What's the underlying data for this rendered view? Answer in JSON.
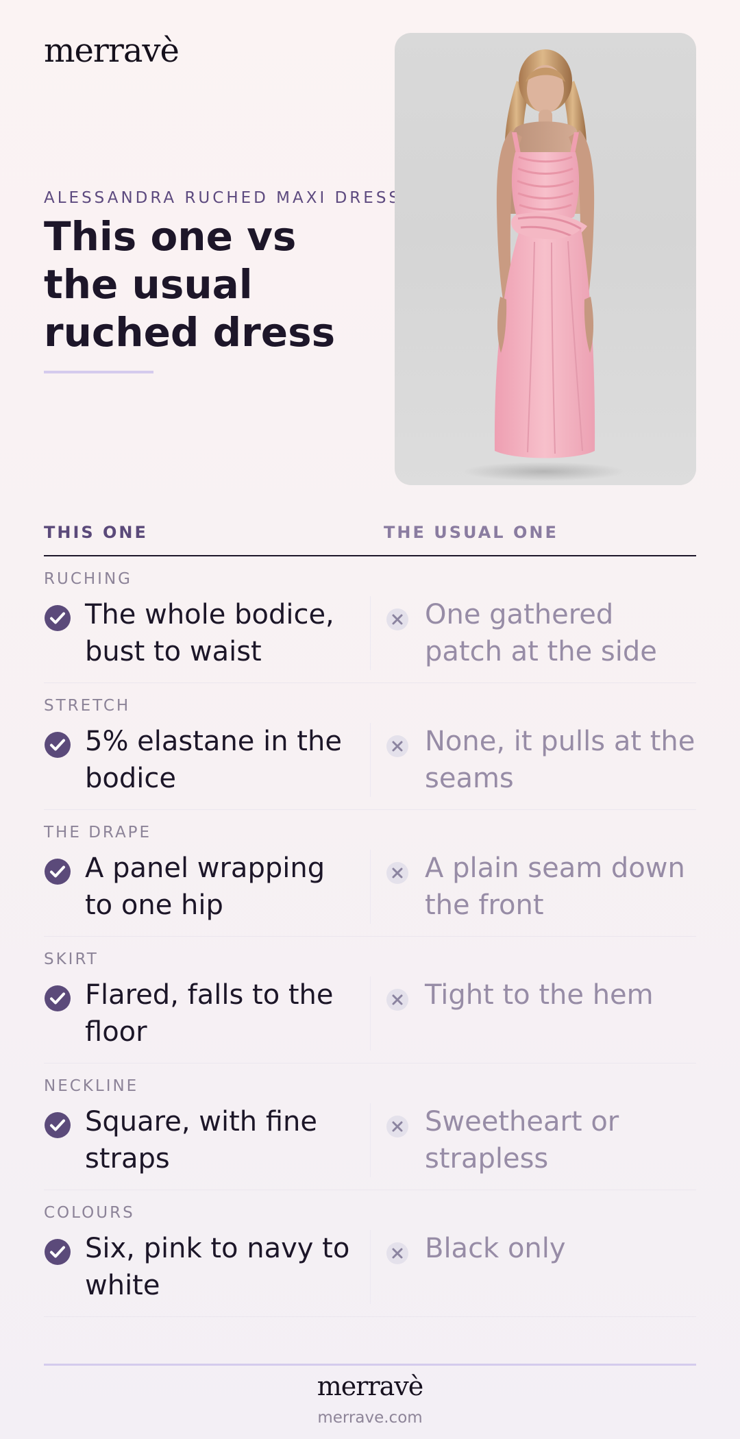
{
  "brand": {
    "name": "merravè",
    "url": "merrave.com"
  },
  "header": {
    "eyebrow": "ALESSANDRA RUCHED MAXI DRESS",
    "headline": "This one vs the usual ruched dress"
  },
  "image": {
    "subject": "pink maxi dress model"
  },
  "comparison": {
    "left_header": "THIS ONE",
    "right_header": "THE USUAL ONE",
    "rows": [
      {
        "label": "RUCHING",
        "left": "The whole bodice, bust to waist",
        "right": "One gathered patch at the side"
      },
      {
        "label": "STRETCH",
        "left": "5% elastane in the bodice",
        "right": "None, it pulls at the seams"
      },
      {
        "label": "THE DRAPE",
        "left": "A panel wrapping to one hip",
        "right": "A plain seam down the front"
      },
      {
        "label": "SKIRT",
        "left": "Flared, falls to the floor",
        "right": "Tight to the hem"
      },
      {
        "label": "NECKLINE",
        "left": "Square, with fine straps",
        "right": "Sweetheart or strapless"
      },
      {
        "label": "COLOURS",
        "left": "Six, pink to navy to white",
        "right": "Black only"
      }
    ]
  },
  "icons": {
    "positive": "check-circle-icon",
    "negative": "x-circle-icon"
  },
  "colors": {
    "accent": "#5b4a7a",
    "muted": "#978ca6",
    "dress": "#f4b8c4",
    "background": "#f8f2f4"
  }
}
